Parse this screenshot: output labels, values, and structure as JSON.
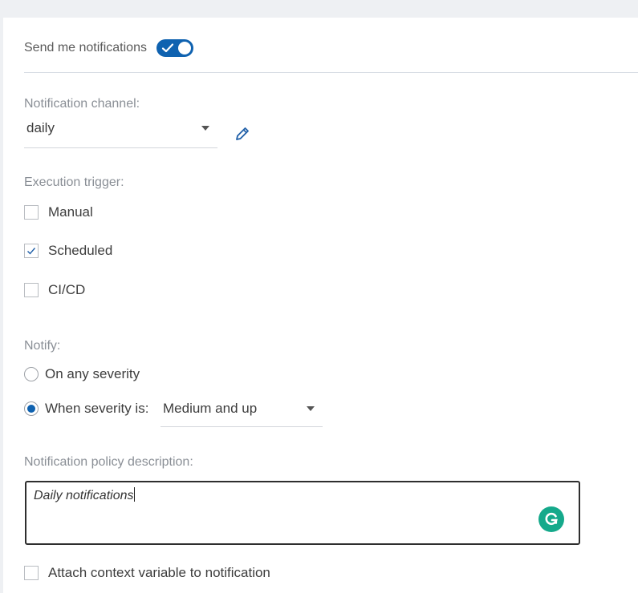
{
  "notifications": {
    "label": "Send me notifications",
    "enabled": true
  },
  "channel": {
    "label": "Notification channel:",
    "value": "daily",
    "edit_icon": "pencil-icon"
  },
  "trigger": {
    "label": "Execution trigger:",
    "options": [
      {
        "label": "Manual",
        "checked": false
      },
      {
        "label": "Scheduled",
        "checked": true
      },
      {
        "label": "CI/CD",
        "checked": false
      }
    ]
  },
  "notify": {
    "label": "Notify:",
    "any_label": "On any severity",
    "when_label": "When severity is:",
    "selected": "when",
    "severity_value": "Medium and up"
  },
  "description": {
    "label": "Notification policy description:",
    "value": "Daily notifications",
    "assistant_icon": "grammarly-icon"
  },
  "attach": {
    "label": "Attach context variable to notification",
    "checked": false
  },
  "colors": {
    "accent": "#0f62b0",
    "grammarly": "#15a98b"
  }
}
